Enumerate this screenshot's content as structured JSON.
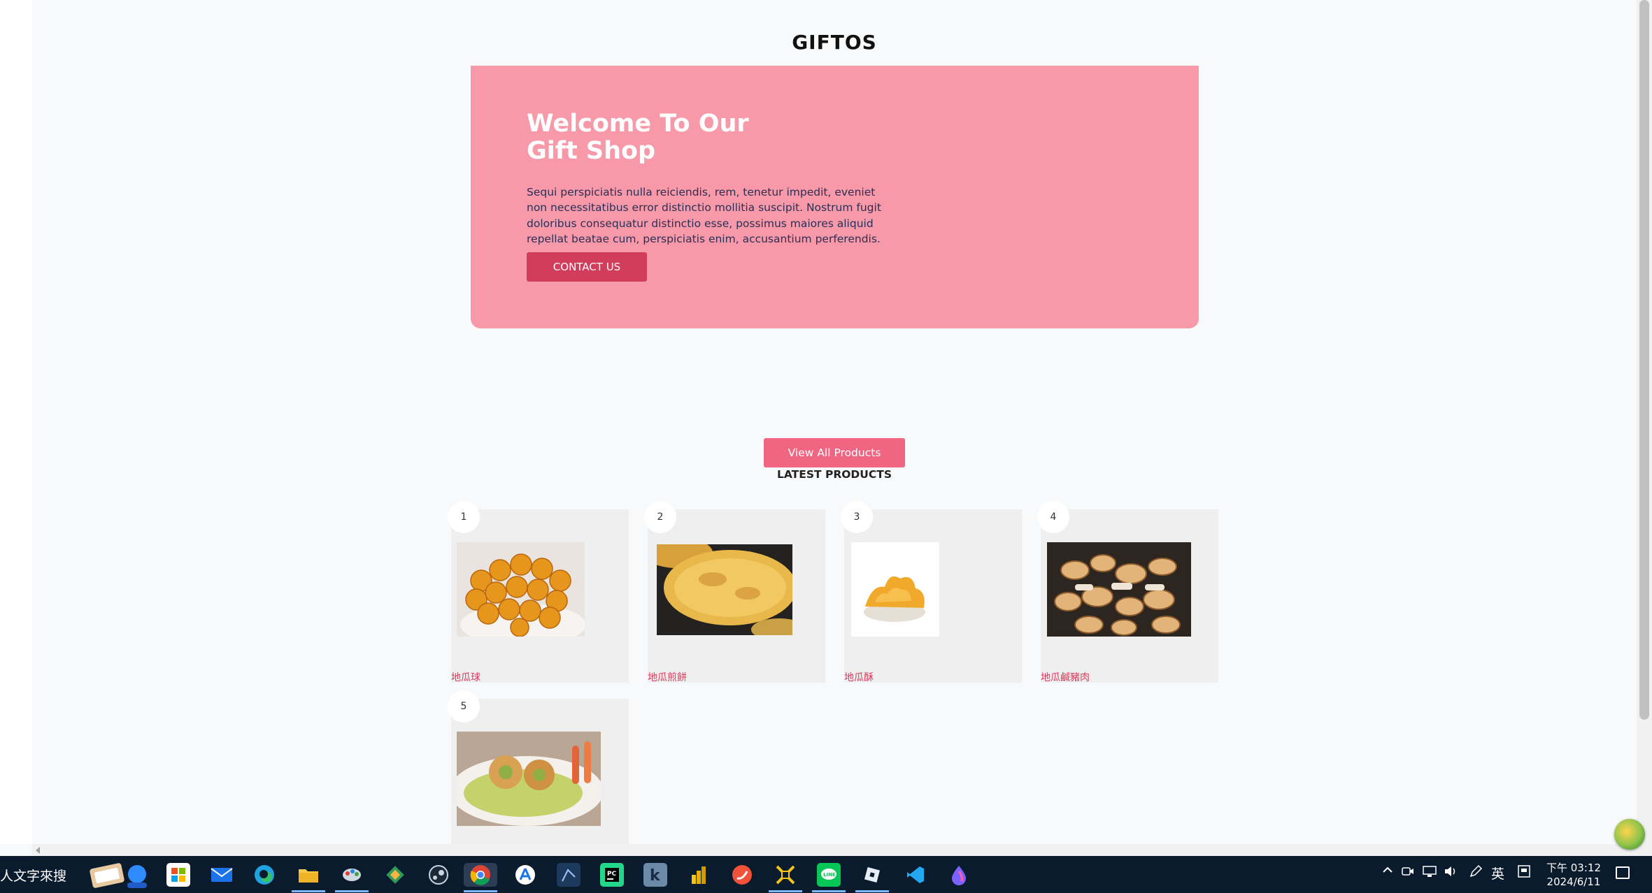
{
  "site": {
    "title": "GIFTOS"
  },
  "hero": {
    "heading_line1": "Welcome To Our",
    "heading_line2": "Gift Shop",
    "text": "Sequi perspiciatis nulla reiciendis, rem, tenetur impedit, eveniet non necessitatibus error distinctio mollitia suscipit. Nostrum fugit doloribus consequatur distinctio esse, possimus maiores aliquid repellat beatae cum, perspiciatis enim, accusantium perferendis.",
    "button": "CONTACT US",
    "bg_color": "#f799a8",
    "button_color": "#d33d5c"
  },
  "products": {
    "view_all": "View All Products",
    "title": "LATEST PRODUCTS",
    "accent": "#dc3a5e",
    "items": [
      {
        "num": "1",
        "name": "地瓜球"
      },
      {
        "num": "2",
        "name": "地瓜煎餅"
      },
      {
        "num": "3",
        "name": "地瓜酥"
      },
      {
        "num": "4",
        "name": "地瓜鹹豬肉"
      },
      {
        "num": "5",
        "name": ""
      }
    ]
  },
  "taskbar": {
    "search_text": "人文字來搜",
    "apps": [
      "windows-store-icon",
      "mail-icon",
      "edge-icon",
      "file-explorer-icon",
      "paint-icon",
      "tools-icon",
      "steam-icon",
      "chrome-icon",
      "app-store-icon",
      "app-icon",
      "pycharm-icon",
      "kotlin-icon",
      "power-bi-icon",
      "swift-icon",
      "tool-icon",
      "line-icon",
      "roblox-icon",
      "vscode-icon",
      "drop-icon"
    ],
    "tray": {
      "ime": "英"
    },
    "clock": {
      "time": "下午 03:12",
      "date": "2024/6/11"
    }
  }
}
